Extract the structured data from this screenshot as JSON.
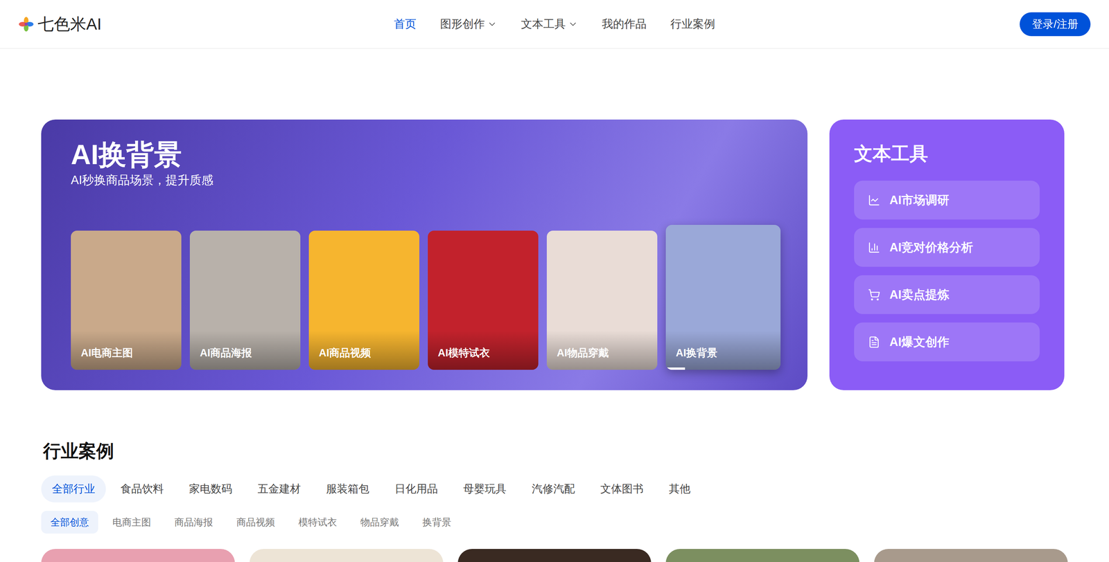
{
  "header": {
    "logo": "七色米AI",
    "nav": [
      {
        "label": "首页",
        "selected": true,
        "dropdown": false
      },
      {
        "label": "图形创作",
        "selected": false,
        "dropdown": true
      },
      {
        "label": "文本工具",
        "selected": false,
        "dropdown": true
      },
      {
        "label": "我的作品",
        "selected": false,
        "dropdown": false
      },
      {
        "label": "行业案例",
        "selected": false,
        "dropdown": false
      }
    ],
    "login_button": "登录/注册"
  },
  "banner": {
    "title": "AI换背景",
    "subtitle": "AI秒换商品场景，提升质感",
    "cards": [
      {
        "label": "AI电商主图",
        "selected": false
      },
      {
        "label": "AI商品海报",
        "selected": false
      },
      {
        "label": "AI商品视频",
        "selected": false
      },
      {
        "label": "AI模特试衣",
        "selected": false
      },
      {
        "label": "AI物品穿戴",
        "selected": false
      },
      {
        "label": "AI换背景",
        "selected": true
      }
    ]
  },
  "text_tools": {
    "title": "文本工具",
    "items": [
      "AI市场调研",
      "AI竞对价格分析",
      "AI卖点提炼",
      "AI爆文创作"
    ]
  },
  "cases": {
    "title": "行业案例",
    "industries": [
      {
        "label": "全部行业",
        "selected": true
      },
      {
        "label": "食品饮料",
        "selected": false
      },
      {
        "label": "家电数码",
        "selected": false
      },
      {
        "label": "五金建材",
        "selected": false
      },
      {
        "label": "服装箱包",
        "selected": false
      },
      {
        "label": "日化用品",
        "selected": false
      },
      {
        "label": "母婴玩具",
        "selected": false
      },
      {
        "label": "汽修汽配",
        "selected": false
      },
      {
        "label": "文体图书",
        "selected": false
      },
      {
        "label": "其他",
        "selected": false
      }
    ],
    "creatives": [
      {
        "label": "全部创意",
        "selected": true
      },
      {
        "label": "电商主图",
        "selected": false
      },
      {
        "label": "商品海报",
        "selected": false
      },
      {
        "label": "商品视频",
        "selected": false
      },
      {
        "label": "模特试衣",
        "selected": false
      },
      {
        "label": "物品穿戴",
        "selected": false
      },
      {
        "label": "换背景",
        "selected": false
      }
    ],
    "cards": [
      {},
      {},
      {},
      {},
      {}
    ]
  }
}
